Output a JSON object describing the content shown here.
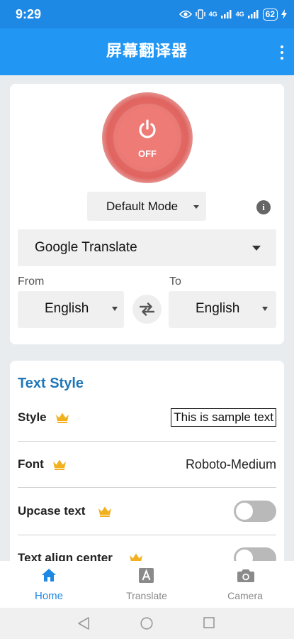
{
  "status": {
    "time": "9:29",
    "network": "4G",
    "battery": "62"
  },
  "app": {
    "title": "屏幕翻译器"
  },
  "power": {
    "state_label": "OFF",
    "color": "#e3625e"
  },
  "mode": {
    "selected": "Default Mode"
  },
  "engine": {
    "selected": "Google Translate"
  },
  "languages": {
    "from_label": "From",
    "to_label": "To",
    "from_value": "English",
    "to_value": "English"
  },
  "text_style": {
    "title": "Text Style",
    "rows": [
      {
        "label": "Style",
        "value": "This is sample text",
        "premium": true
      },
      {
        "label": "Font",
        "value": "Roboto-Medium",
        "premium": true
      },
      {
        "label": "Upcase text",
        "toggle": false,
        "premium": true
      },
      {
        "label": "Text align center",
        "toggle": false,
        "premium": true
      }
    ]
  },
  "bottom_nav": {
    "items": [
      {
        "label": "Home",
        "icon": "home-icon",
        "active": true
      },
      {
        "label": "Translate",
        "icon": "translate-icon",
        "active": false
      },
      {
        "label": "Camera",
        "icon": "camera-icon",
        "active": false
      }
    ]
  },
  "colors": {
    "primary": "#2196f3",
    "status_bar": "#1e88e5",
    "accent_text": "#1f77b9",
    "crown": "#f2b01e"
  }
}
